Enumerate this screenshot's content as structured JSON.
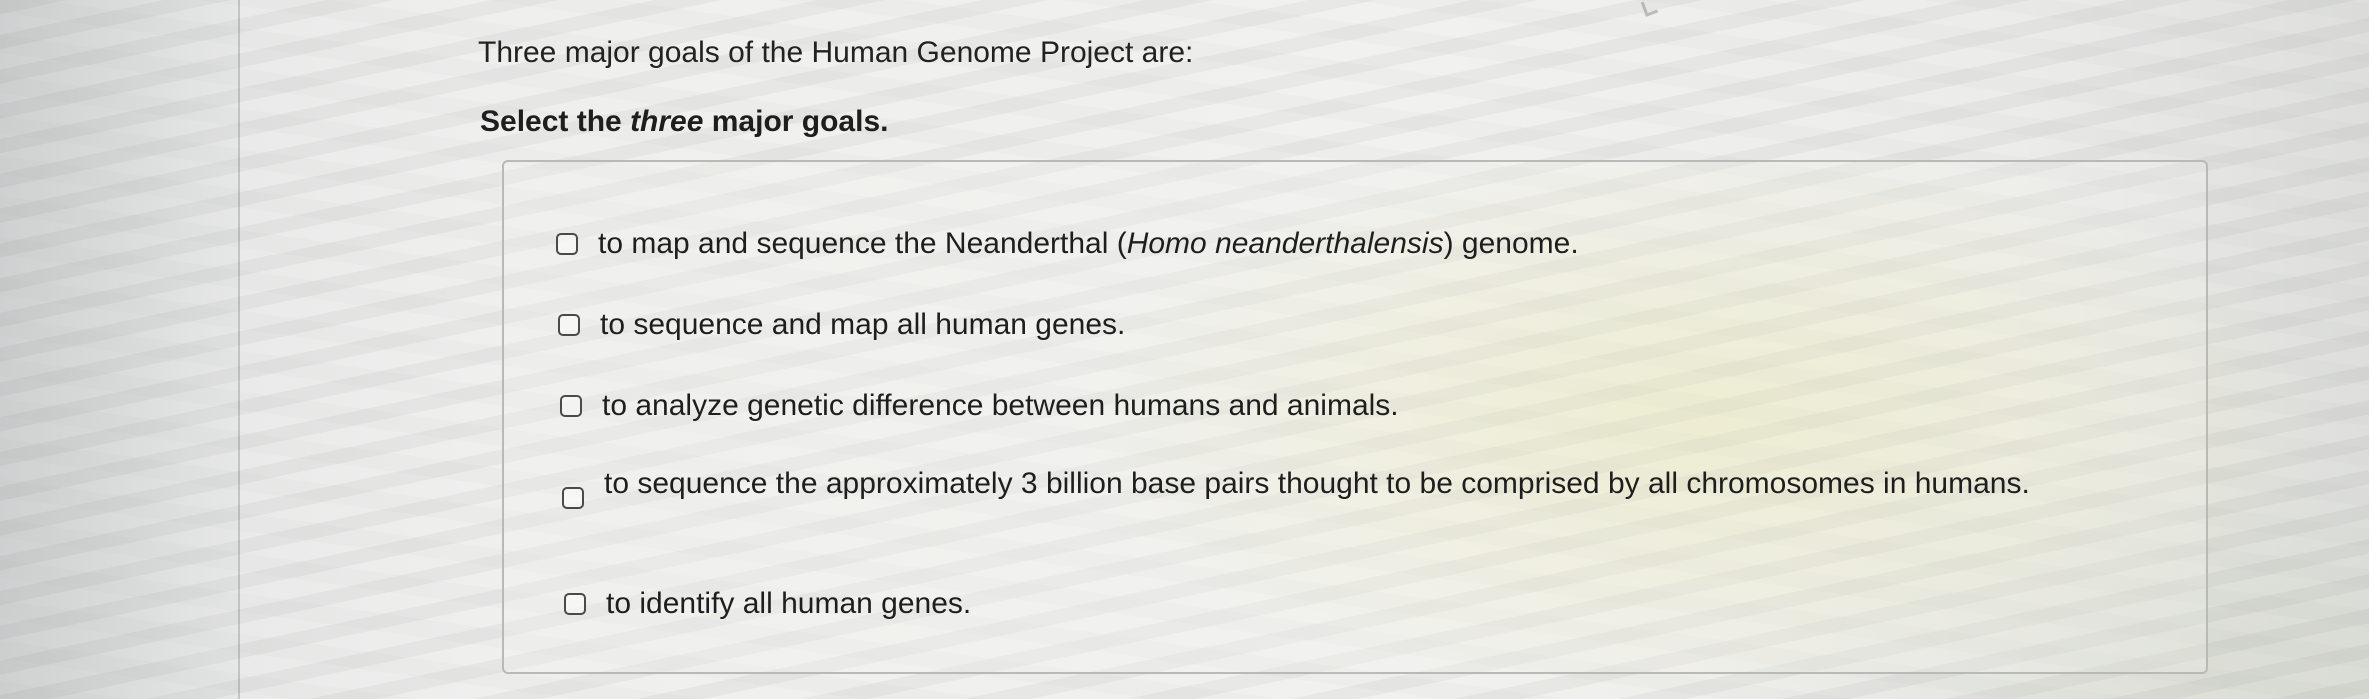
{
  "question": {
    "prompt": "Three major goals of the Human Genome Project are:",
    "instruction_before": "Select the ",
    "instruction_emphasis": "three",
    "instruction_after": " major goals."
  },
  "options": [
    {
      "text_before": "to map and sequence the Neanderthal (",
      "text_italic": "Homo neanderthalensis",
      "text_after": ") genome.",
      "checked": false
    },
    {
      "text": "to sequence and map all human genes.",
      "checked": false
    },
    {
      "text": "to analyze genetic difference between humans and animals.",
      "checked": false
    },
    {
      "text": "to sequence the approximately 3 billion base pairs thought to be comprised by all chromosomes in humans.",
      "checked": false
    },
    {
      "text": "to identify all human genes.",
      "checked": false
    }
  ]
}
